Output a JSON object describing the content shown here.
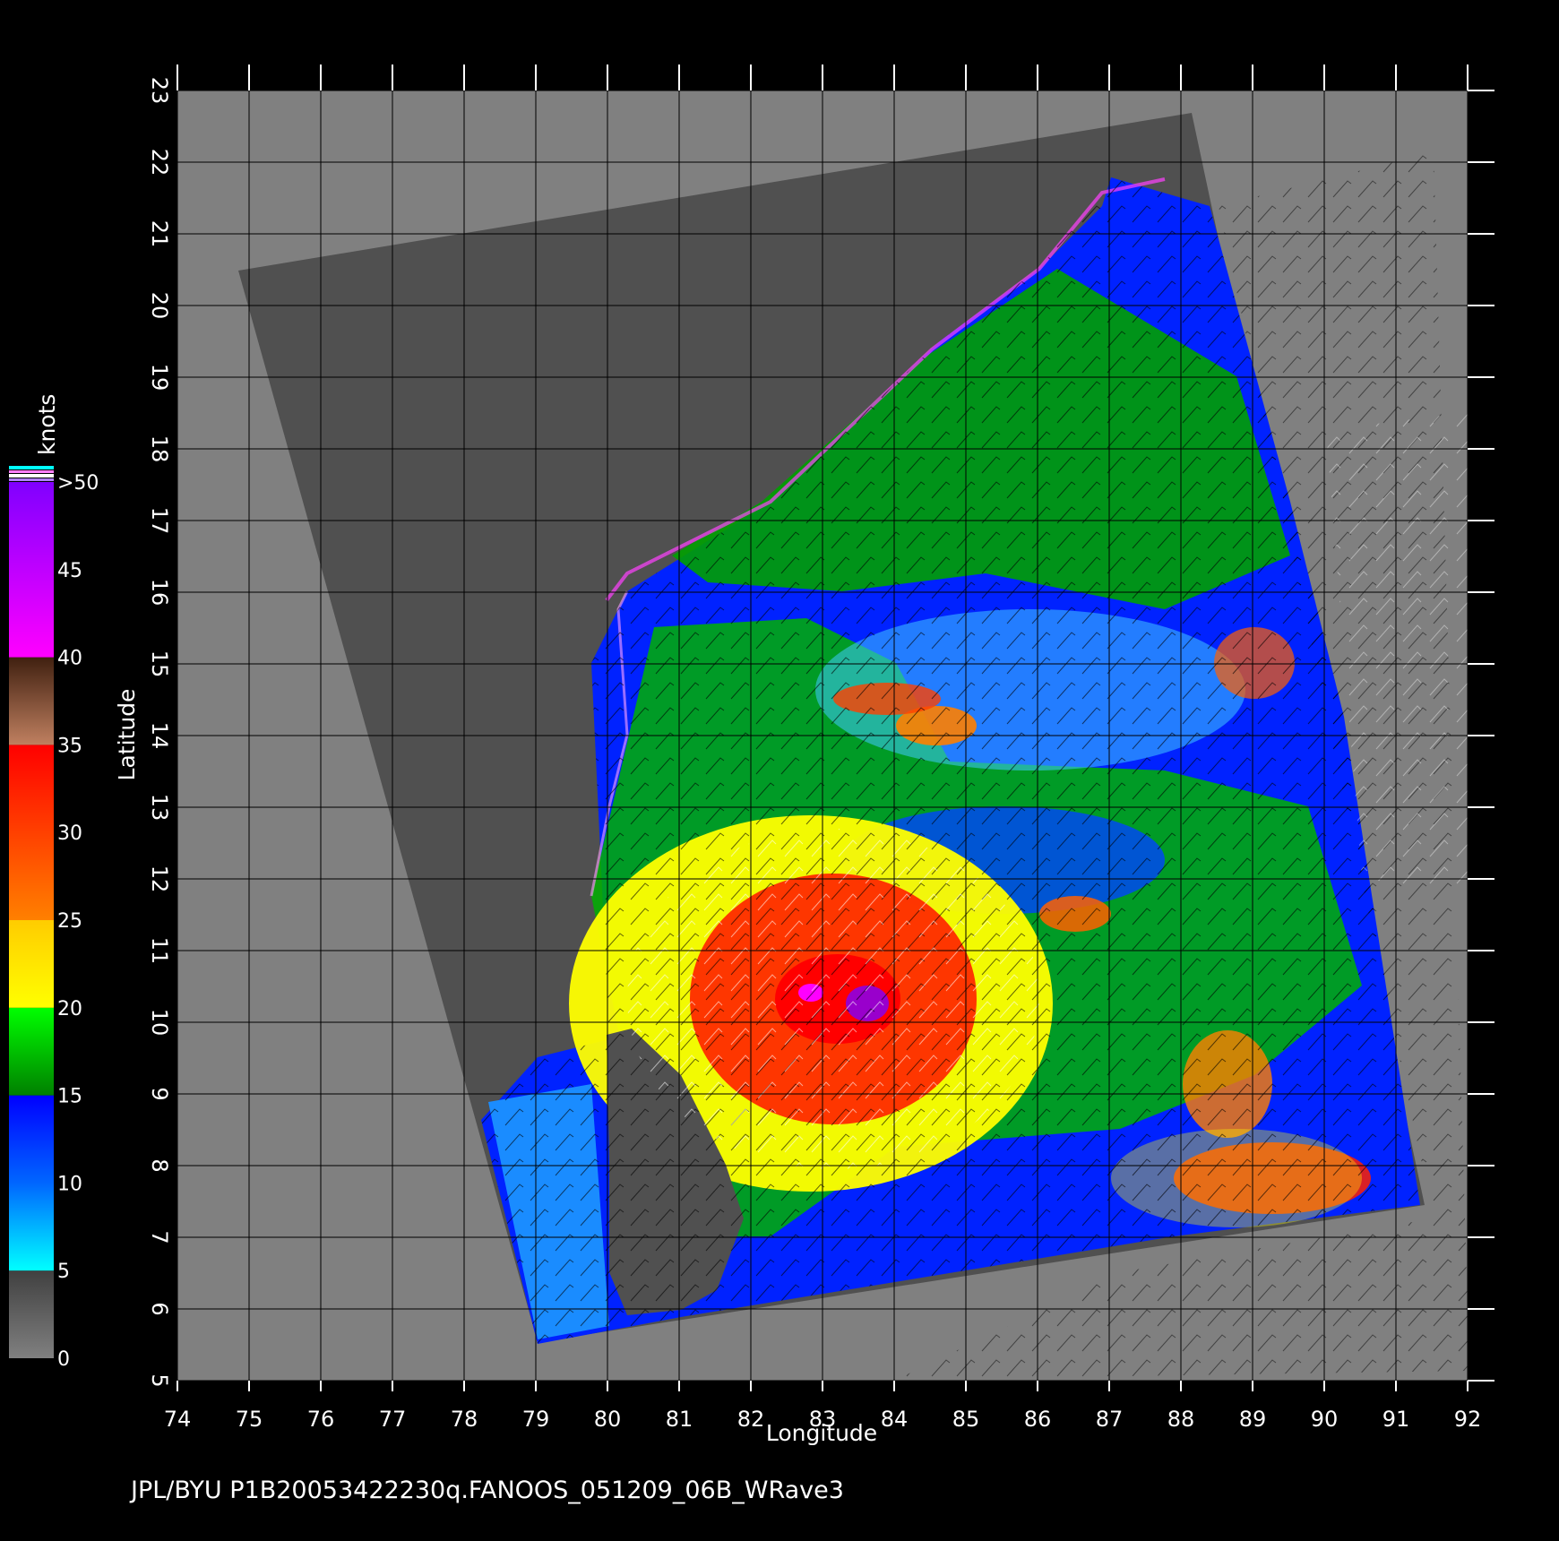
{
  "map": {
    "x_label": "Longitude",
    "y_label": "Latitude",
    "lon_range": [
      74,
      92
    ],
    "lat_range": [
      5,
      23
    ],
    "lon_ticks": [
      "74",
      "75",
      "76",
      "77",
      "78",
      "79",
      "80",
      "81",
      "82",
      "83",
      "84",
      "85",
      "86",
      "87",
      "88",
      "89",
      "90",
      "91",
      "92"
    ],
    "lat_ticks": [
      "5",
      "6",
      "7",
      "8",
      "9",
      "10",
      "11",
      "12",
      "13",
      "14",
      "15",
      "16",
      "17",
      "18",
      "19",
      "20",
      "21",
      "22",
      "23"
    ],
    "colors": {
      "background_land": "#808080",
      "swath": "#505050",
      "grid": "#000000"
    }
  },
  "colorbar": {
    "units": "knots",
    "labels": [
      ">50",
      "45",
      "40",
      "35",
      "30",
      "25",
      "20",
      "15",
      "10",
      "5",
      "0"
    ],
    "bands": [
      {
        "from": 0,
        "to": 5,
        "colors": [
          "#808080",
          "#404040"
        ]
      },
      {
        "from": 5,
        "to": 15,
        "colors": [
          "#00ffff",
          "#0066ff",
          "#0000ff"
        ]
      },
      {
        "from": 15,
        "to": 20,
        "colors": [
          "#008000",
          "#00ff00"
        ]
      },
      {
        "from": 20,
        "to": 25,
        "colors": [
          "#ffff00",
          "#ffcc00"
        ]
      },
      {
        "from": 25,
        "to": 35,
        "colors": [
          "#ff8000",
          "#ff0000"
        ]
      },
      {
        "from": 35,
        "to": 40,
        "colors": [
          "#c08060",
          "#402010"
        ]
      },
      {
        "from": 40,
        "to": 50,
        "colors": [
          "#ff00ff",
          "#8000ff"
        ]
      }
    ]
  },
  "storm_center": {
    "lon": 83.2,
    "lat": 10.2
  },
  "footer": "JPL/BYU  P1B20053422230q.FANOOS_051209_06B_WRave3"
}
